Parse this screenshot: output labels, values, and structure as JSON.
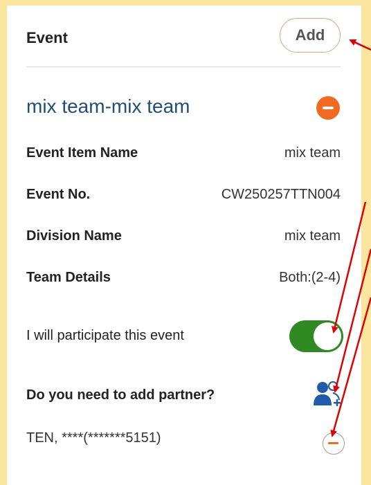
{
  "header": {
    "title": "Event",
    "add_label": "Add"
  },
  "event": {
    "title": "mix team-mix team",
    "details": [
      {
        "label": "Event Item Name",
        "value": "mix team"
      },
      {
        "label": "Event No.",
        "value": "CW250257TTN004"
      },
      {
        "label": "Division Name",
        "value": "mix team"
      },
      {
        "label": "Team Details",
        "value": "Both:(2-4)"
      }
    ],
    "participate_label": "I will participate this event",
    "participate_on": true,
    "partner_question": "Do you need to add partner?",
    "partner_entry": "TEN, ****(*******5151)"
  },
  "colors": {
    "accent_orange": "#f26a21",
    "toggle_green": "#2f8a22",
    "title_blue": "#1f4e79",
    "annotation_red": "#e00000",
    "page_border_yellow": "#fbe6a0"
  }
}
